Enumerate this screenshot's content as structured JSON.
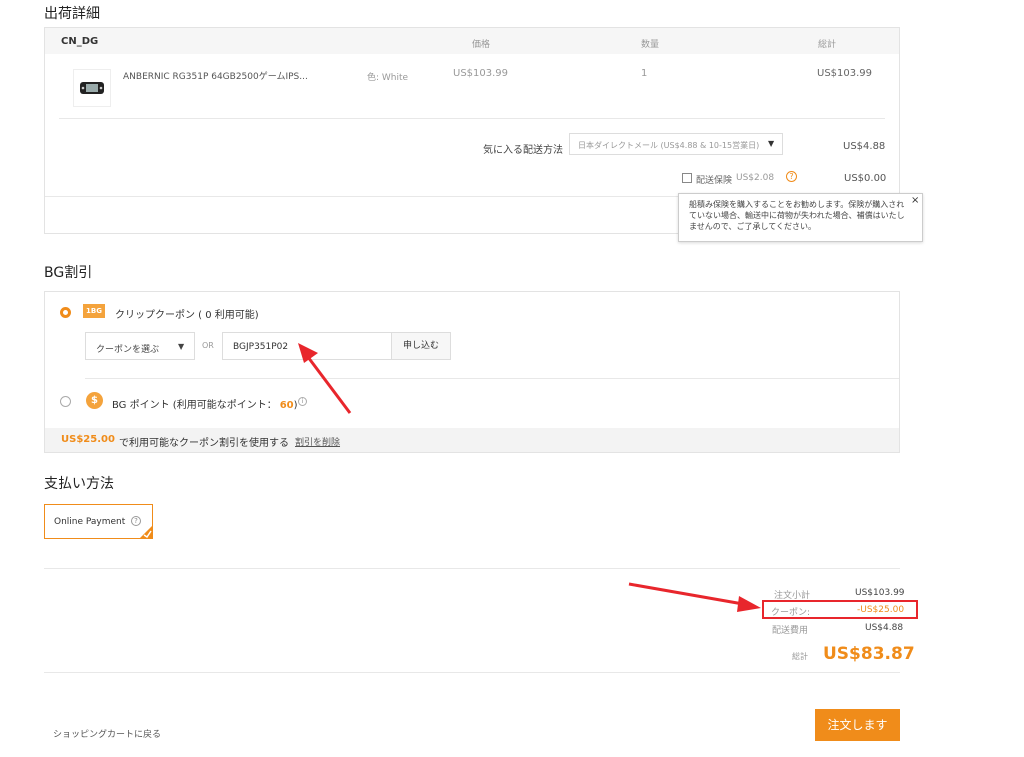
{
  "shipping": {
    "title": "出荷詳細",
    "warehouse": "CN_DG",
    "headers": {
      "price": "価格",
      "qty": "数量",
      "total": "総計"
    },
    "product": {
      "name": "ANBERNIC RG351P 64GB2500ゲームIPS...",
      "color": "色: White",
      "price": "US$103.99",
      "qty": "1",
      "total": "US$103.99"
    },
    "method_label": "気に入る配送方法",
    "method_value": "日本ダイレクトメール (US$4.88 & 10-15営業日)",
    "method_cost": "US$4.88",
    "insurance_label": "配送保険",
    "insurance_price": "US$2.08",
    "insurance_cost": "US$0.00",
    "tooltip": "船積み保険を購入することをお勧めします。保険が購入されていない場合、輸送中に荷物が失われた場合、補償はいたしませんので、ご了承してください。",
    "tooltip_close": "×"
  },
  "discount": {
    "title": "BG割引",
    "coupon_badge": "1BG",
    "coupon_label": "クリップクーポン ( 0 利用可能)",
    "select_placeholder": "クーポンを選ぶ",
    "or_text": "OR",
    "code_value": "BGJP351P02",
    "apply_label": "申し込む",
    "points_label": "BG ポイント (利用可能なポイント：",
    "points_value": "60",
    "points_close": ")",
    "applied_amount": "US$25.00",
    "applied_text": "で利用可能なクーポン割引を使用する",
    "remove_label": "割引を削除"
  },
  "payment": {
    "title": "支払い方法",
    "option": "Online Payment"
  },
  "summary": {
    "subtotal_label": "注文小計",
    "subtotal_value": "US$103.99",
    "coupon_label": "クーポン:",
    "coupon_value": "-US$25.00",
    "shipping_label": "配送費用",
    "shipping_value": "US$4.88",
    "total_label": "総計",
    "total_value": "US$83.87"
  },
  "footer": {
    "back_label": "ショッピングカートに戻る",
    "order_label": "注文します"
  },
  "colors": {
    "accent": "#f08c1a",
    "annotation": "#e8262c"
  }
}
